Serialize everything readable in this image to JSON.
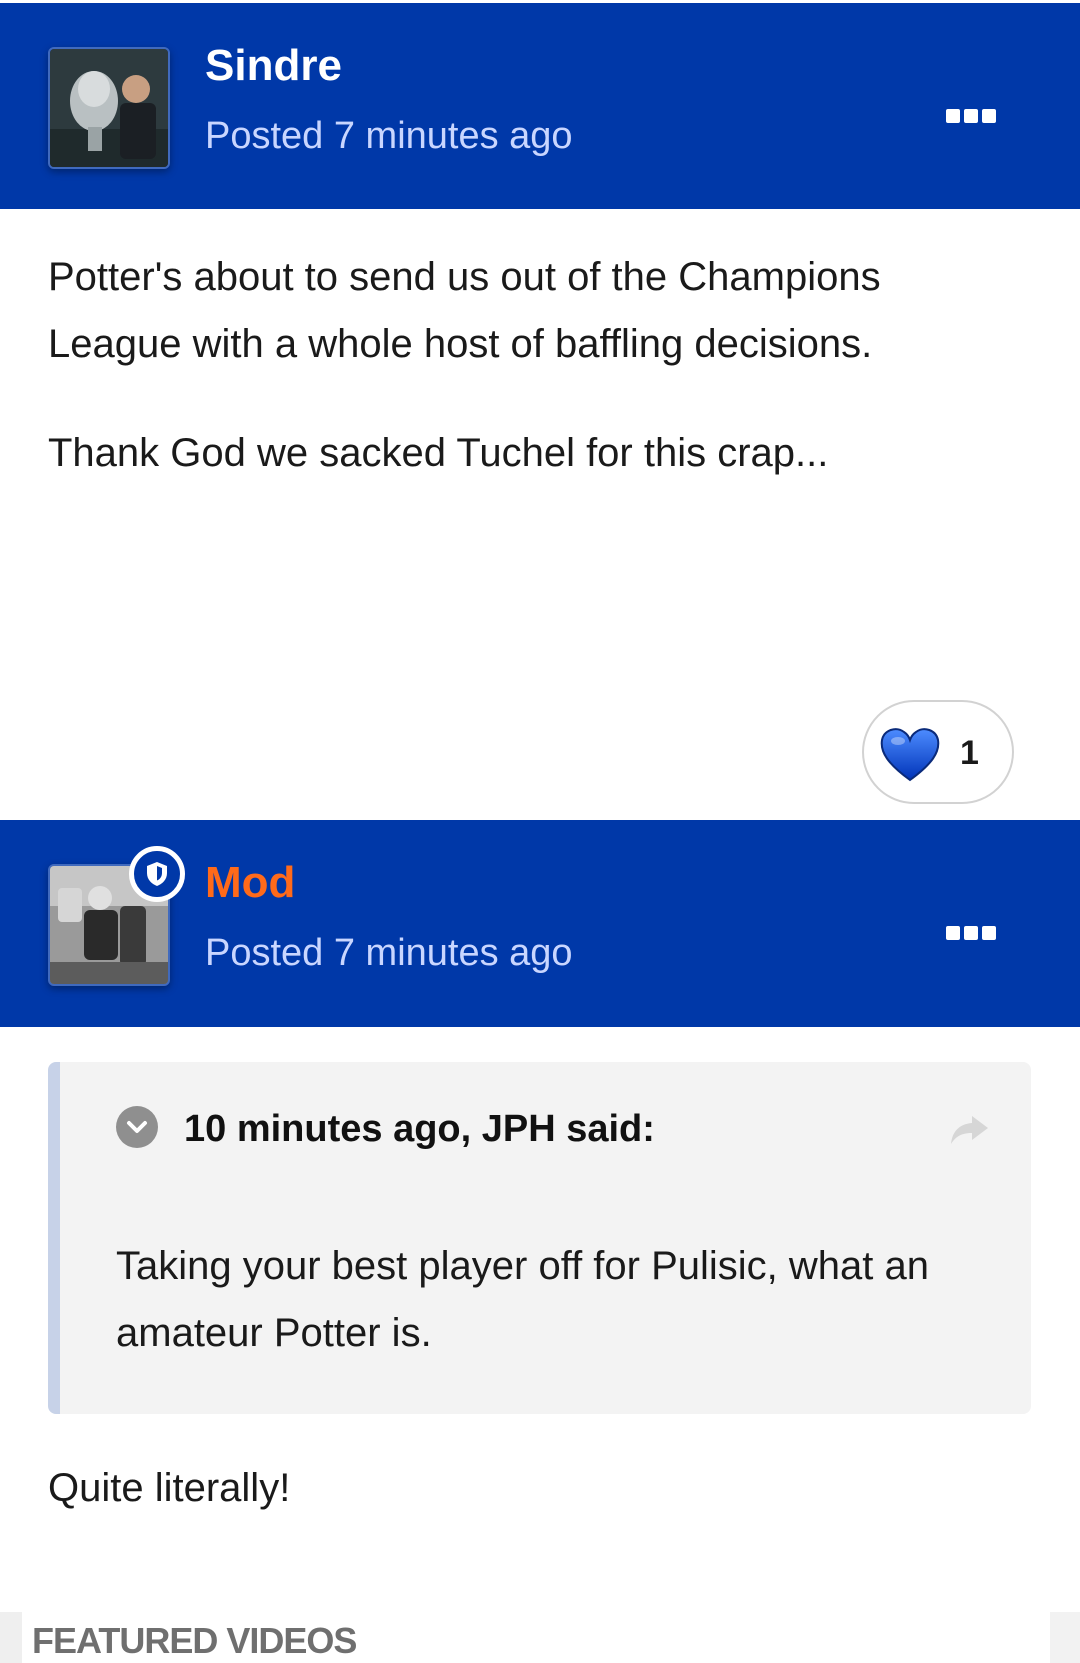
{
  "posts": [
    {
      "author": "Sindre",
      "posted": "Posted 7 minutes ago",
      "paragraphs": [
        "Potter's about to send us out of the Champions League with a whole host of baffling decisions.",
        "Thank God we sacked Tuchel for this crap..."
      ],
      "reaction": {
        "icon": "heart-icon",
        "count": "1"
      }
    },
    {
      "author": "Mod",
      "posted": "Posted 7 minutes ago",
      "quote": {
        "citation": "10 minutes ago, JPH said:",
        "text": "Taking your best player off for Pulisic, what an amateur Potter is."
      },
      "reply": "Quite literally!"
    }
  ],
  "featured": {
    "label": "FEATURED VIDEOS"
  },
  "colors": {
    "header_bg": "#0038a8",
    "username": "#ffffff",
    "mod_name": "#ff6a1a",
    "posted_text": "#c9d6ff",
    "heart": "#0a4fd6"
  }
}
